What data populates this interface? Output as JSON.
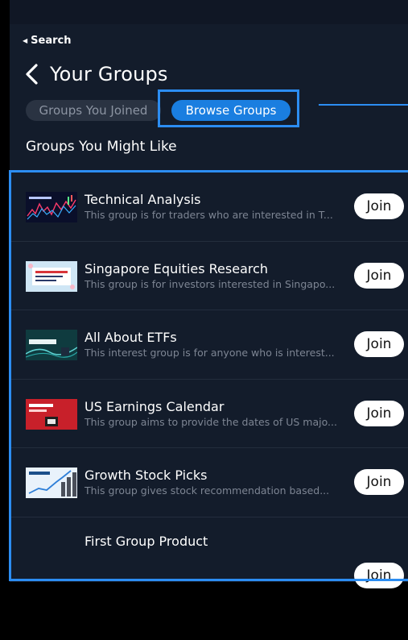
{
  "status_bar": {
    "back_label": "Search"
  },
  "header": {
    "title": "Your Groups"
  },
  "tabs": [
    {
      "label": "Groups You Joined",
      "active": false
    },
    {
      "label": "Browse Groups",
      "active": true
    }
  ],
  "section": {
    "title": "Groups You Might Like"
  },
  "groups": [
    {
      "name": "Technical Analysis",
      "description": "This group is for traders who are interested in T...",
      "join_label": "Join",
      "thumbnail": "technical-analysis-chart"
    },
    {
      "name": "Singapore Equities Research",
      "description": "This group is for investors interested in Singapo...",
      "join_label": "Join",
      "thumbnail": "singapore-research-banner"
    },
    {
      "name": "All About ETFs",
      "description": "This interest group is for anyone who is interest...",
      "join_label": "Join",
      "thumbnail": "etf-banner"
    },
    {
      "name": "US Earnings Calendar",
      "description": "This group aims to provide the dates of US majo...",
      "join_label": "Join",
      "thumbnail": "earnings-calendar-banner"
    },
    {
      "name": "Growth Stock Picks",
      "description": "This group gives stock recommendation based...",
      "join_label": "Join",
      "thumbnail": "growth-chart"
    },
    {
      "name": "First Group Product",
      "description": "",
      "join_label": "Join",
      "thumbnail": ""
    }
  ],
  "colors": {
    "background": "#131c2b",
    "accent": "#1a7ee0",
    "highlight": "#2c8df2",
    "inactive_tab": "#2a3342"
  }
}
